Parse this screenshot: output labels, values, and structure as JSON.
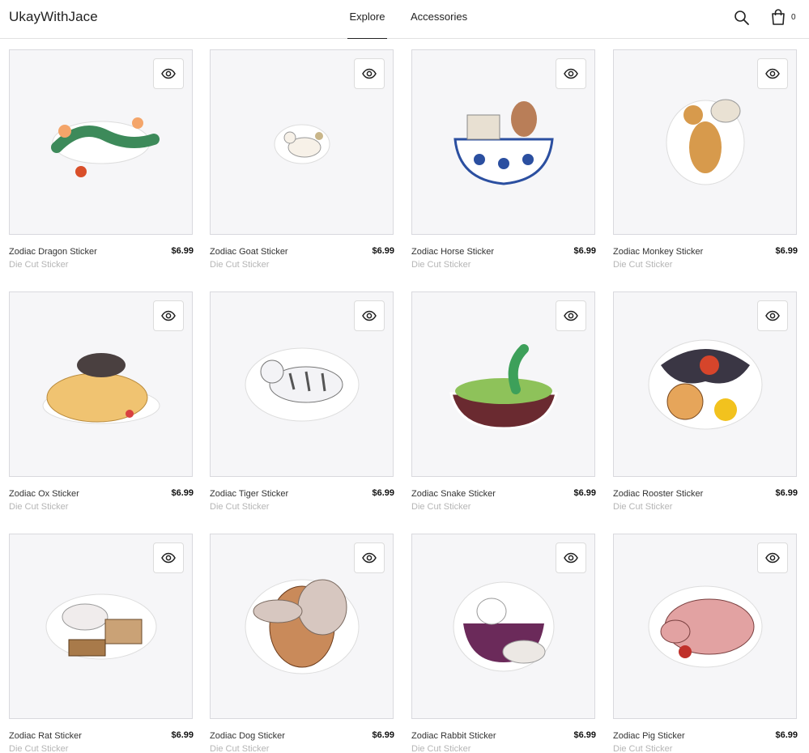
{
  "header": {
    "brand": "UkayWithJace",
    "nav": [
      {
        "label": "Explore",
        "active": true
      },
      {
        "label": "Accessories",
        "active": false
      }
    ],
    "search_icon": "search-icon",
    "cart_icon": "shopping-bag-icon",
    "cart_count": "0"
  },
  "products": [
    {
      "name": "Zodiac Dragon Sticker",
      "price": "$6.99",
      "subtitle": "Die Cut Sticker"
    },
    {
      "name": "Zodiac Goat Sticker",
      "price": "$6.99",
      "subtitle": "Die Cut Sticker"
    },
    {
      "name": "Zodiac Horse Sticker",
      "price": "$6.99",
      "subtitle": "Die Cut Sticker"
    },
    {
      "name": "Zodiac Monkey Sticker",
      "price": "$6.99",
      "subtitle": "Die Cut Sticker"
    },
    {
      "name": "Zodiac Ox Sticker",
      "price": "$6.99",
      "subtitle": "Die Cut Sticker"
    },
    {
      "name": "Zodiac Tiger Sticker",
      "price": "$6.99",
      "subtitle": "Die Cut Sticker"
    },
    {
      "name": "Zodiac Snake Sticker",
      "price": "$6.99",
      "subtitle": "Die Cut Sticker"
    },
    {
      "name": "Zodiac Rooster Sticker",
      "price": "$6.99",
      "subtitle": "Die Cut Sticker"
    },
    {
      "name": "Zodiac Rat Sticker",
      "price": "$6.99",
      "subtitle": "Die Cut Sticker"
    },
    {
      "name": "Zodiac Dog Sticker",
      "price": "$6.99",
      "subtitle": "Die Cut Sticker"
    },
    {
      "name": "Zodiac Rabbit Sticker",
      "price": "$6.99",
      "subtitle": "Die Cut Sticker"
    },
    {
      "name": "Zodiac Pig Sticker",
      "price": "$6.99",
      "subtitle": "Die Cut Sticker"
    }
  ],
  "quick_view_icon": "eye-icon",
  "colors": {
    "card_bg": "#f6f6f8",
    "subtitle": "#b5b5b5",
    "text": "#222222"
  }
}
